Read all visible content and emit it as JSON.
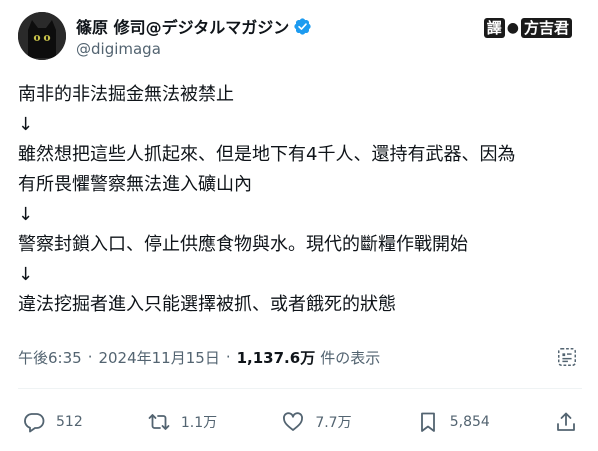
{
  "author": {
    "display_name": "篠原 修司@デジタルマガジン",
    "handle": "@digimaga",
    "verified": true,
    "avatar_icon": "black-cat-avatar"
  },
  "watermark": {
    "left": "譯",
    "right": "方吉君"
  },
  "post": {
    "lines": [
      "南非的非法掘金無法被禁止",
      "↓",
      "雖然想把這些人抓起來、但是地下有4千人、還持有武器、因為",
      "有所畏懼警察無法進入礦山內",
      "↓",
      "警察封鎖入口、停止供應食物與水。現代的斷糧作戰開始",
      "↓",
      "違法挖掘者進入只能選擇被抓、或者餓死的狀態"
    ]
  },
  "meta": {
    "time": "午後6:35",
    "separator": "·",
    "date": "2024年11月15日",
    "views_count": "1,137.6万",
    "views_label": "件の表示"
  },
  "actions": {
    "replies": "512",
    "reposts": "1.1万",
    "likes": "7.7万",
    "bookmarks": "5,854"
  },
  "colors": {
    "text": "#0f1419",
    "secondary": "#536471",
    "verified": "#1d9bf0",
    "divider": "#eff3f4"
  }
}
